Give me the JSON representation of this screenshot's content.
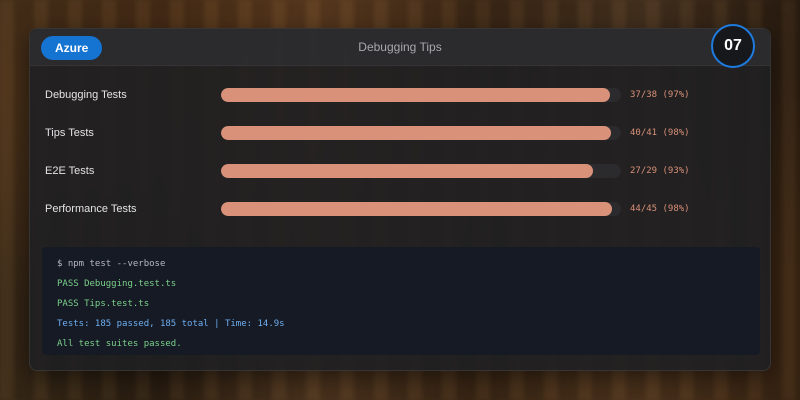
{
  "header": {
    "badge_label": "Azure",
    "title": "Debugging Tips",
    "number": "07"
  },
  "progress_rows": [
    {
      "label": "Debugging Tests",
      "value_text": "37/38 (97%)",
      "passed": 37,
      "total": 38
    },
    {
      "label": "Tips Tests",
      "value_text": "40/41 (98%)",
      "passed": 40,
      "total": 41
    },
    {
      "label": "E2E Tests",
      "value_text": "27/29 (93%)",
      "passed": 27,
      "total": 29
    },
    {
      "label": "Performance Tests",
      "value_text": "44/45 (98%)",
      "passed": 44,
      "total": 45
    }
  ],
  "terminal": {
    "lines": [
      "$ npm test --verbose",
      "PASS Debugging.test.ts",
      "PASS Tips.test.ts",
      "Tests: 185 passed, 185 total | Time: 14.9s",
      "All test suites passed."
    ]
  },
  "colors": {
    "accent": "#1573d1",
    "bar_fill": "#d9917a",
    "pass_text": "#7cd08a",
    "info_text": "#6eaef2"
  }
}
